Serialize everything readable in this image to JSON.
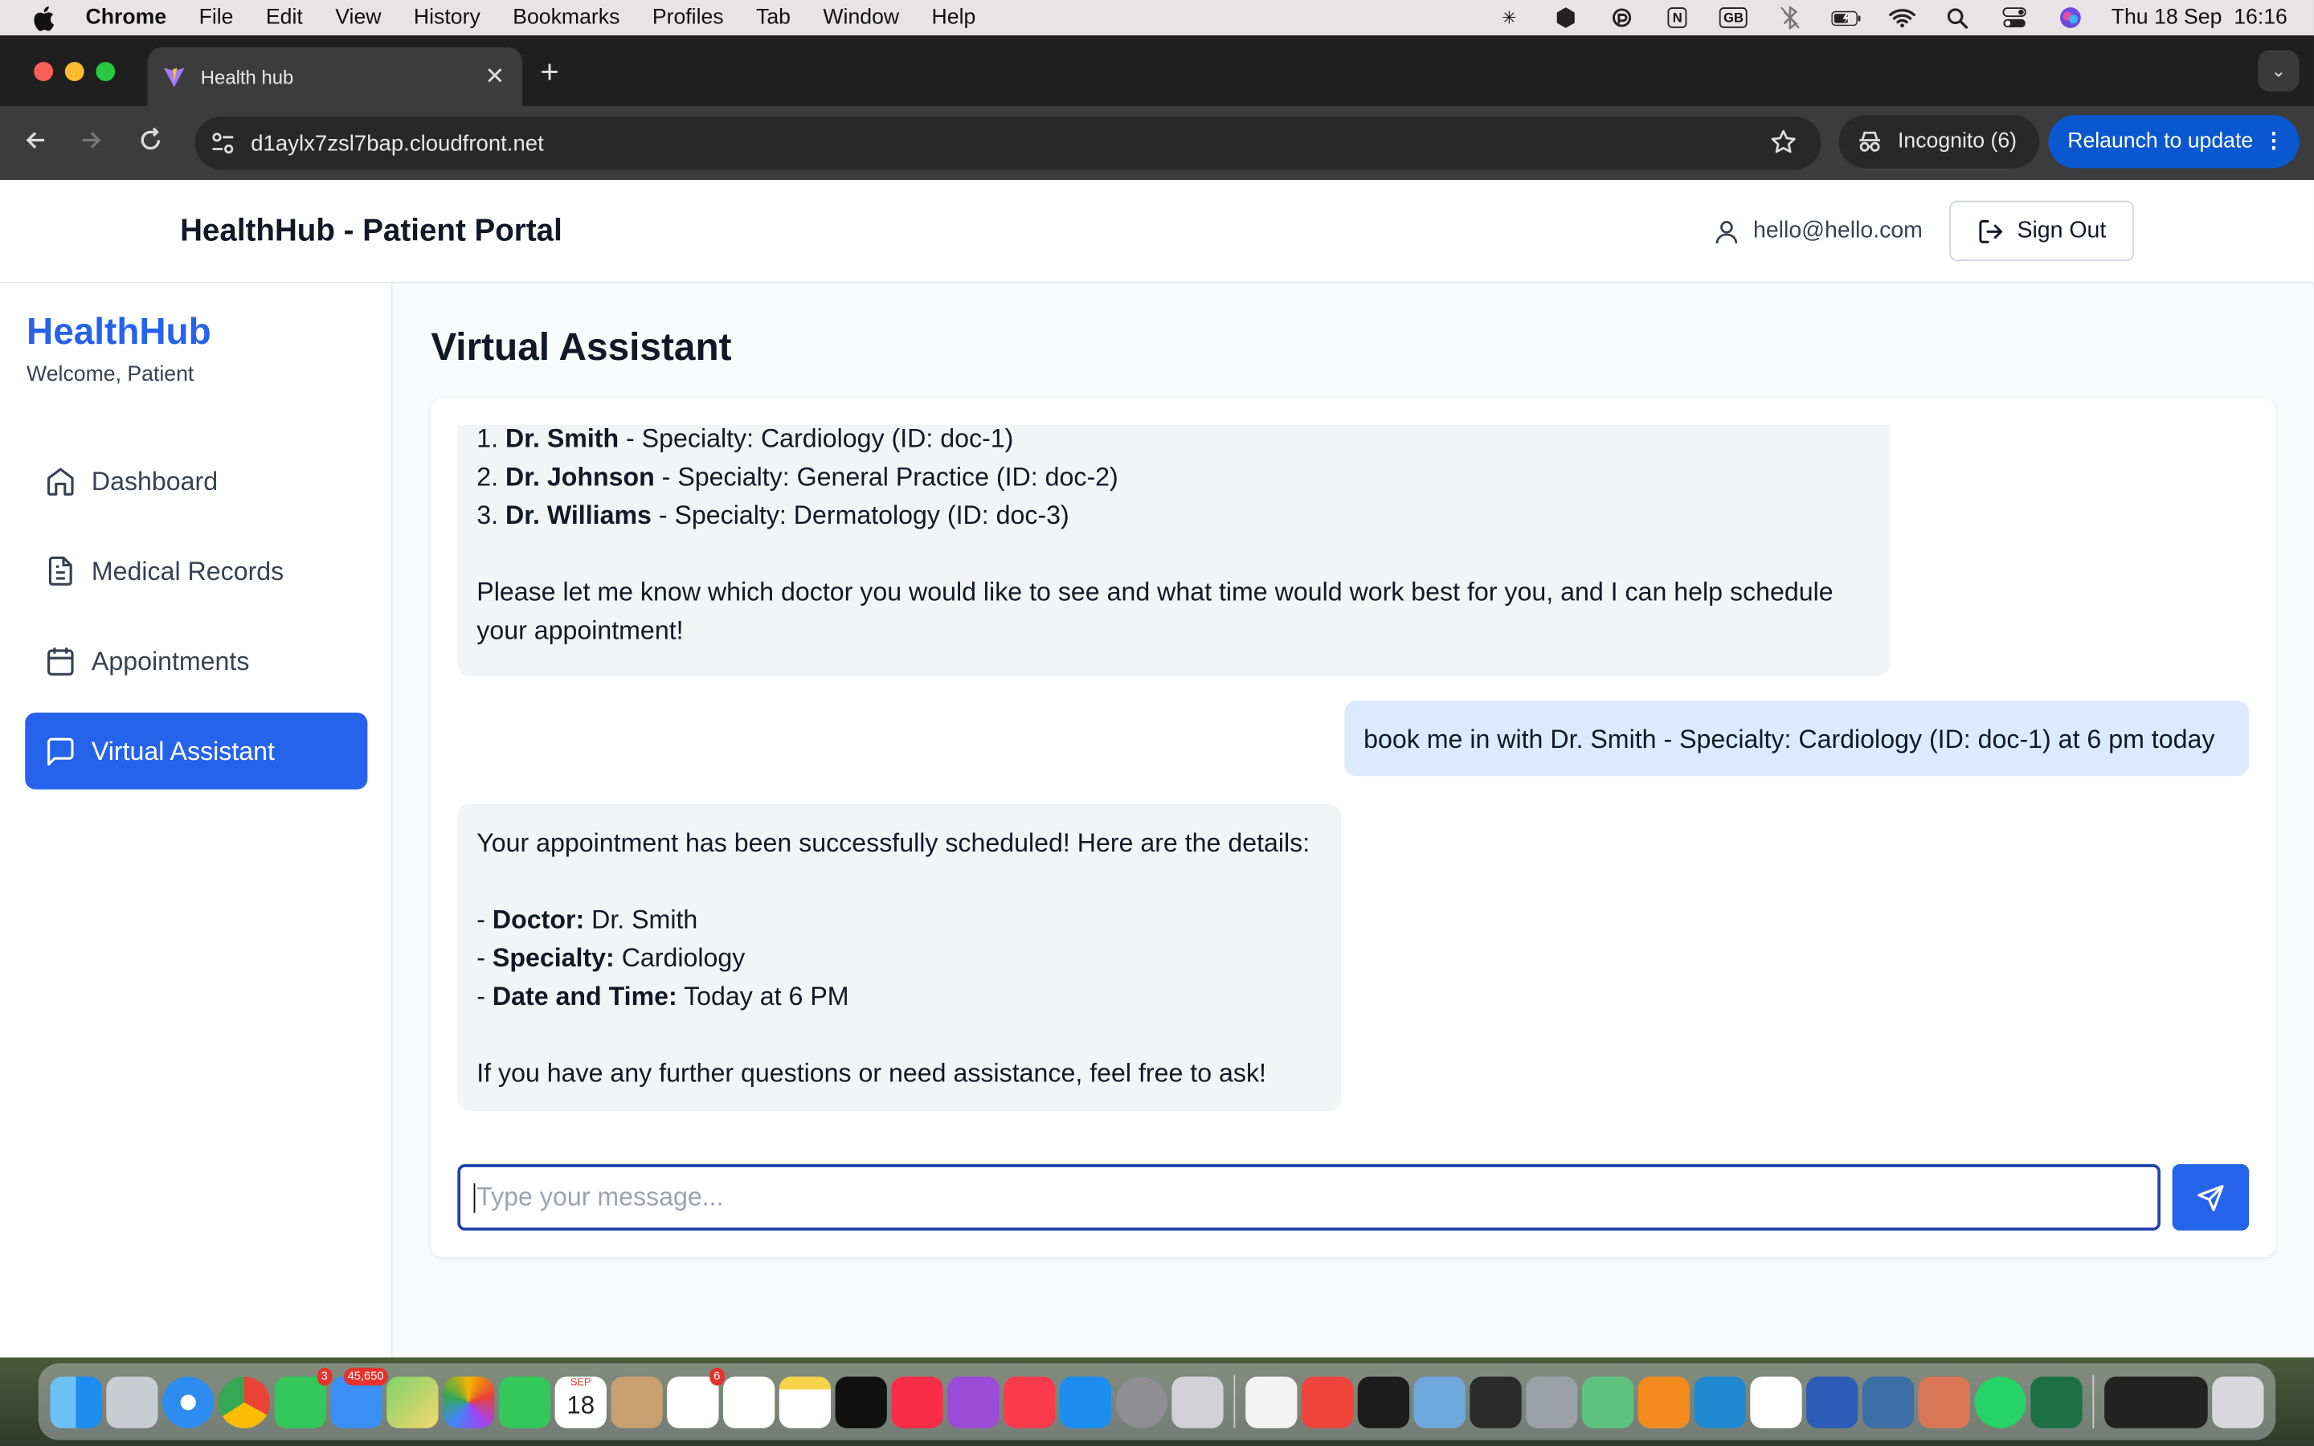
{
  "menubar": {
    "app_name": "Chrome",
    "items": [
      "File",
      "Edit",
      "View",
      "History",
      "Bookmarks",
      "Profiles",
      "Tab",
      "Window",
      "Help"
    ],
    "keyboard_layout": "GB",
    "notion_label": "N",
    "clock": "Thu 18 Sep  16:16"
  },
  "browser": {
    "tab_title": "Health hub",
    "tab_close": "✕",
    "new_tab": "+",
    "url": "d1aylx7zsl7bap.cloudfront.net",
    "incognito_label": "Incognito (6)",
    "relaunch_label": "Relaunch to update"
  },
  "header": {
    "title": "HealthHub - Patient Portal",
    "user_email": "hello@hello.com",
    "signout_label": "Sign Out"
  },
  "sidebar": {
    "brand": "HealthHub",
    "welcome": "Welcome, Patient",
    "items": [
      {
        "label": "Dashboard",
        "icon": "home-icon",
        "active": false
      },
      {
        "label": "Medical Records",
        "icon": "file-text-icon",
        "active": false
      },
      {
        "label": "Appointments",
        "icon": "calendar-icon",
        "active": false
      },
      {
        "label": "Virtual Assistant",
        "icon": "message-square-icon",
        "active": true
      }
    ]
  },
  "main": {
    "title": "Virtual Assistant",
    "messages": [
      {
        "role": "assistant",
        "lines": [
          {
            "prefix": "1. ",
            "bold": "Dr. Smith",
            "text": " - Specialty: Cardiology (ID: doc-1)"
          },
          {
            "prefix": "2. ",
            "bold": "Dr. Johnson",
            "text": " - Specialty: General Practice (ID: doc-2)"
          },
          {
            "prefix": "3. ",
            "bold": "Dr. Williams",
            "text": " - Specialty: Dermatology (ID: doc-3)"
          }
        ],
        "closing": "Please let me know which doctor you would like to see and what time would work best for you, and I can help schedule your appointment!"
      },
      {
        "role": "user",
        "text": "book me in with Dr. Smith - Specialty: Cardiology (ID: doc-1) at 6 pm today"
      },
      {
        "role": "assistant",
        "intro": "Your appointment has been successfully scheduled! Here are the details:",
        "details": [
          {
            "bold": "Doctor:",
            "text": " Dr. Smith"
          },
          {
            "bold": "Specialty:",
            "text": " Cardiology"
          },
          {
            "bold": "Date and Time:",
            "text": " Today at 6 PM"
          }
        ],
        "closing": "If you have any further questions or need assistance, feel free to ask!"
      }
    ],
    "input_placeholder": "Type your message...",
    "send_icon": "send-icon"
  },
  "dock": {
    "badges": {
      "messages": "3",
      "mail": "45,650",
      "calendar_month": "SEP",
      "calendar_day": "18",
      "reminders": "6"
    }
  },
  "colors": {
    "accent": "#2563eb",
    "user_bubble": "#dbeafe",
    "bot_bubble": "#f3f4f6",
    "relaunch": "#0b57d0"
  }
}
